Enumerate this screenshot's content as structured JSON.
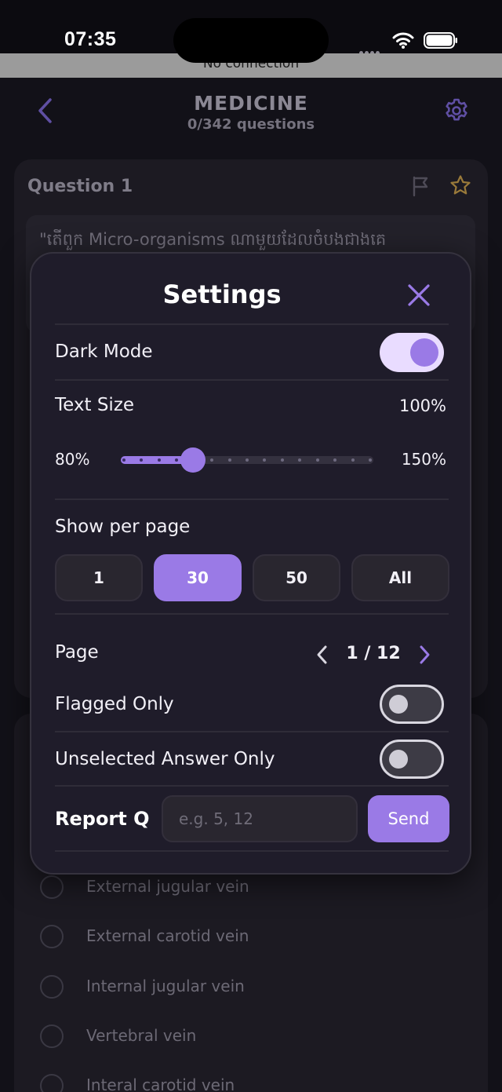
{
  "status_bar": {
    "time": "07:35"
  },
  "banner": {
    "text": "No connection"
  },
  "header": {
    "title": "MEDICINE",
    "subtitle": "0/342 questions"
  },
  "question": {
    "title": "Question 1",
    "text": "\"តើពួក Micro-organisms ណាមួយដែលចំបងជាងគេ"
  },
  "answers": [
    {
      "label": "External jugular vein"
    },
    {
      "label": "External carotid vein"
    },
    {
      "label": "Internal jugular vein"
    },
    {
      "label": "Vertebral vein"
    },
    {
      "label": "Interal carotid vein"
    }
  ],
  "settings": {
    "title": "Settings",
    "dark_mode": {
      "label": "Dark Mode",
      "on": true
    },
    "text_size": {
      "label": "Text Size",
      "value": "100%",
      "min_label": "80%",
      "max_label": "150%",
      "level_fraction": 0.2857
    },
    "per_page": {
      "label": "Show per page",
      "options": [
        "1",
        "30",
        "50",
        "All"
      ],
      "selected": "30"
    },
    "page": {
      "label": "Page",
      "value": "1 / 12"
    },
    "flagged_only": {
      "label": "Flagged Only",
      "on": false
    },
    "unselected_only": {
      "label": "Unselected Answer Only",
      "on": false
    },
    "report": {
      "label": "Report Q",
      "placeholder": "e.g. 5, 12",
      "button": "Send"
    }
  },
  "colors": {
    "accent": "#9a7ae6",
    "toggle_on_track": "#e9dcff",
    "modal_bg": "#1f1c2a",
    "page_bg": "#121118"
  }
}
